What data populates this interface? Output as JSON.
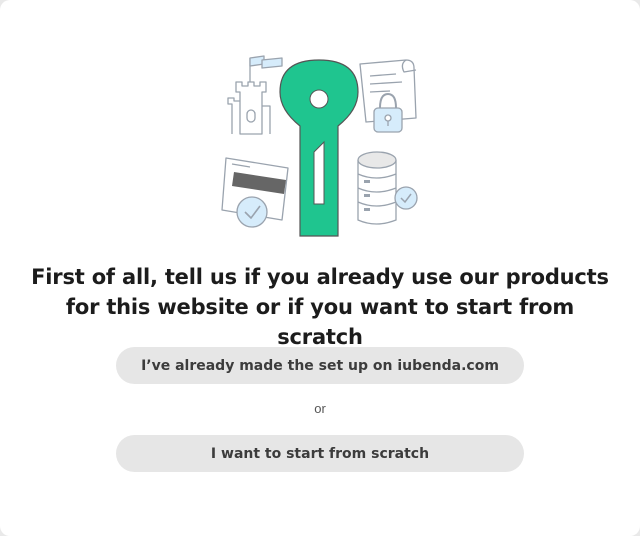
{
  "illustration": {
    "accent": "#1fc58f",
    "line": "#9aa3ae",
    "tint": "#d6ecfb",
    "dark": "#666666"
  },
  "onboarding": {
    "headline_line1": "First of all, tell us if you already use our products",
    "headline_line2": "for this website or if you want to start from scratch",
    "existing_setup_label": "I’ve already made the set up on iubenda.com",
    "separator_text": "or",
    "scratch_label": "I want to start from scratch"
  }
}
